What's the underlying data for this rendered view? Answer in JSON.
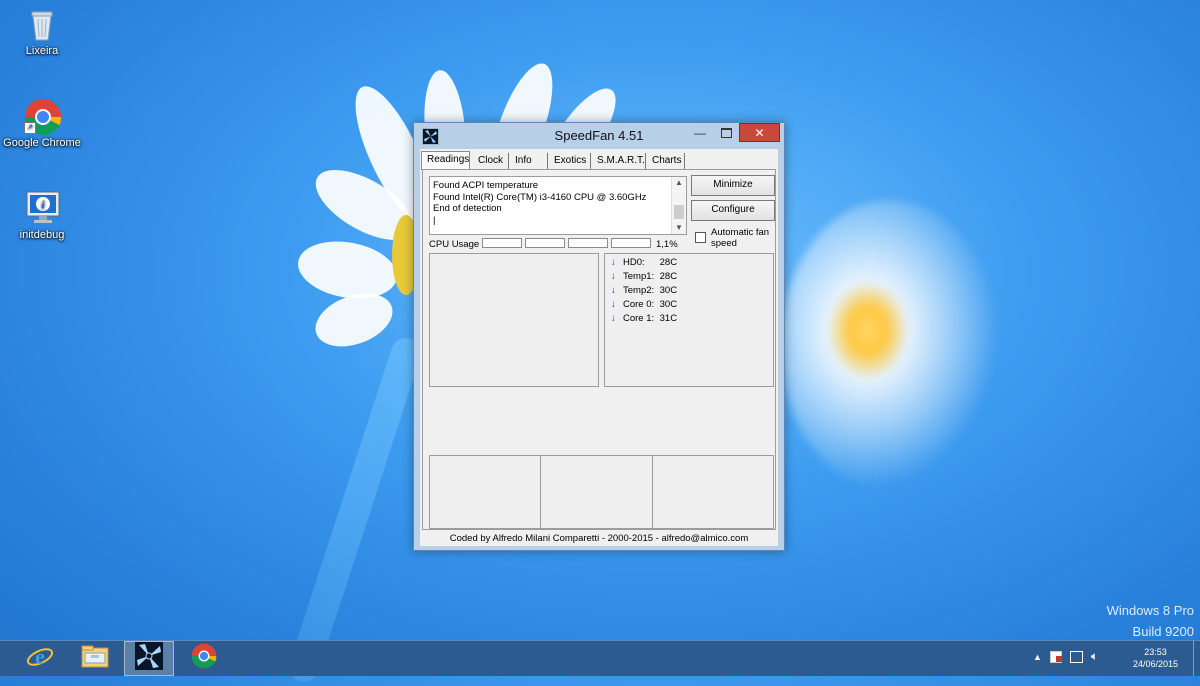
{
  "desktop": {
    "icons": [
      {
        "label": "Lixeira",
        "icon": "recycle-bin-icon"
      },
      {
        "label": "Google Chrome",
        "icon": "chrome-icon"
      },
      {
        "label": "initdebug",
        "icon": "monitor-info-icon"
      }
    ],
    "watermark": {
      "line1": "Windows 8 Pro",
      "line2": "Build 9200"
    }
  },
  "window": {
    "title": "SpeedFan 4.51",
    "tabs": [
      "Readings",
      "Clock",
      "Info",
      "Exotics",
      "S.M.A.R.T.",
      "Charts"
    ],
    "selected_tab": "Readings",
    "log": [
      "Found ACPI temperature",
      "Found Intel(R) Core(TM) i3-4160 CPU @ 3.60GHz",
      "End of detection"
    ],
    "buttons": {
      "minimize": "Minimize",
      "configure": "Configure"
    },
    "auto_fan": {
      "label": "Automatic fan speed",
      "checked": false
    },
    "cpu_usage": {
      "label": "CPU Usage",
      "value": "1,1%"
    },
    "readings": [
      {
        "name": "HD0:",
        "value": "28C",
        "trend": "down"
      },
      {
        "name": "Temp1:",
        "value": "28C",
        "trend": "down"
      },
      {
        "name": "Temp2:",
        "value": "30C",
        "trend": "down"
      },
      {
        "name": "Core 0:",
        "value": "30C",
        "trend": "down"
      },
      {
        "name": "Core 1:",
        "value": "31C",
        "trend": "down"
      }
    ],
    "footer": "Coded by Alfredo Milani Comparetti - 2000-2015 - alfredo@almico.com"
  },
  "taskbar": {
    "apps": [
      "internet-explorer-icon",
      "file-explorer-icon",
      "speedfan-icon",
      "chrome-icon"
    ],
    "active_app": "speedfan-icon",
    "clock": {
      "time": "23:53",
      "date": "24/06/2015"
    }
  }
}
